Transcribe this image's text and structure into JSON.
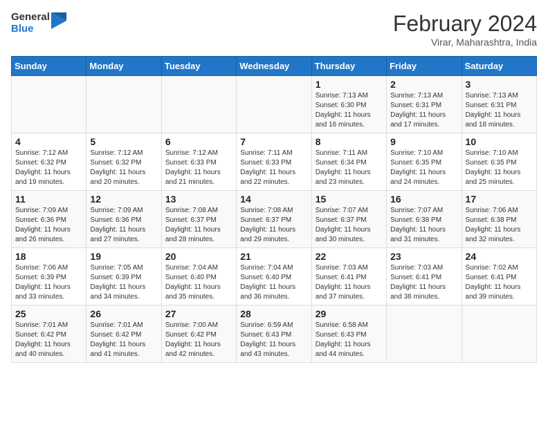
{
  "header": {
    "logo_general": "General",
    "logo_blue": "Blue",
    "title": "February 2024",
    "subtitle": "Virar, Maharashtra, India"
  },
  "weekdays": [
    "Sunday",
    "Monday",
    "Tuesday",
    "Wednesday",
    "Thursday",
    "Friday",
    "Saturday"
  ],
  "weeks": [
    [
      {
        "day": "",
        "info": ""
      },
      {
        "day": "",
        "info": ""
      },
      {
        "day": "",
        "info": ""
      },
      {
        "day": "",
        "info": ""
      },
      {
        "day": "1",
        "info": "Sunrise: 7:13 AM\nSunset: 6:30 PM\nDaylight: 11 hours and 16 minutes."
      },
      {
        "day": "2",
        "info": "Sunrise: 7:13 AM\nSunset: 6:31 PM\nDaylight: 11 hours and 17 minutes."
      },
      {
        "day": "3",
        "info": "Sunrise: 7:13 AM\nSunset: 6:31 PM\nDaylight: 11 hours and 18 minutes."
      }
    ],
    [
      {
        "day": "4",
        "info": "Sunrise: 7:12 AM\nSunset: 6:32 PM\nDaylight: 11 hours and 19 minutes."
      },
      {
        "day": "5",
        "info": "Sunrise: 7:12 AM\nSunset: 6:32 PM\nDaylight: 11 hours and 20 minutes."
      },
      {
        "day": "6",
        "info": "Sunrise: 7:12 AM\nSunset: 6:33 PM\nDaylight: 11 hours and 21 minutes."
      },
      {
        "day": "7",
        "info": "Sunrise: 7:11 AM\nSunset: 6:33 PM\nDaylight: 11 hours and 22 minutes."
      },
      {
        "day": "8",
        "info": "Sunrise: 7:11 AM\nSunset: 6:34 PM\nDaylight: 11 hours and 23 minutes."
      },
      {
        "day": "9",
        "info": "Sunrise: 7:10 AM\nSunset: 6:35 PM\nDaylight: 11 hours and 24 minutes."
      },
      {
        "day": "10",
        "info": "Sunrise: 7:10 AM\nSunset: 6:35 PM\nDaylight: 11 hours and 25 minutes."
      }
    ],
    [
      {
        "day": "11",
        "info": "Sunrise: 7:09 AM\nSunset: 6:36 PM\nDaylight: 11 hours and 26 minutes."
      },
      {
        "day": "12",
        "info": "Sunrise: 7:09 AM\nSunset: 6:36 PM\nDaylight: 11 hours and 27 minutes."
      },
      {
        "day": "13",
        "info": "Sunrise: 7:08 AM\nSunset: 6:37 PM\nDaylight: 11 hours and 28 minutes."
      },
      {
        "day": "14",
        "info": "Sunrise: 7:08 AM\nSunset: 6:37 PM\nDaylight: 11 hours and 29 minutes."
      },
      {
        "day": "15",
        "info": "Sunrise: 7:07 AM\nSunset: 6:37 PM\nDaylight: 11 hours and 30 minutes."
      },
      {
        "day": "16",
        "info": "Sunrise: 7:07 AM\nSunset: 6:38 PM\nDaylight: 11 hours and 31 minutes."
      },
      {
        "day": "17",
        "info": "Sunrise: 7:06 AM\nSunset: 6:38 PM\nDaylight: 11 hours and 32 minutes."
      }
    ],
    [
      {
        "day": "18",
        "info": "Sunrise: 7:06 AM\nSunset: 6:39 PM\nDaylight: 11 hours and 33 minutes."
      },
      {
        "day": "19",
        "info": "Sunrise: 7:05 AM\nSunset: 6:39 PM\nDaylight: 11 hours and 34 minutes."
      },
      {
        "day": "20",
        "info": "Sunrise: 7:04 AM\nSunset: 6:40 PM\nDaylight: 11 hours and 35 minutes."
      },
      {
        "day": "21",
        "info": "Sunrise: 7:04 AM\nSunset: 6:40 PM\nDaylight: 11 hours and 36 minutes."
      },
      {
        "day": "22",
        "info": "Sunrise: 7:03 AM\nSunset: 6:41 PM\nDaylight: 11 hours and 37 minutes."
      },
      {
        "day": "23",
        "info": "Sunrise: 7:03 AM\nSunset: 6:41 PM\nDaylight: 11 hours and 38 minutes."
      },
      {
        "day": "24",
        "info": "Sunrise: 7:02 AM\nSunset: 6:41 PM\nDaylight: 11 hours and 39 minutes."
      }
    ],
    [
      {
        "day": "25",
        "info": "Sunrise: 7:01 AM\nSunset: 6:42 PM\nDaylight: 11 hours and 40 minutes."
      },
      {
        "day": "26",
        "info": "Sunrise: 7:01 AM\nSunset: 6:42 PM\nDaylight: 11 hours and 41 minutes."
      },
      {
        "day": "27",
        "info": "Sunrise: 7:00 AM\nSunset: 6:42 PM\nDaylight: 11 hours and 42 minutes."
      },
      {
        "day": "28",
        "info": "Sunrise: 6:59 AM\nSunset: 6:43 PM\nDaylight: 11 hours and 43 minutes."
      },
      {
        "day": "29",
        "info": "Sunrise: 6:58 AM\nSunset: 6:43 PM\nDaylight: 11 hours and 44 minutes."
      },
      {
        "day": "",
        "info": ""
      },
      {
        "day": "",
        "info": ""
      }
    ]
  ]
}
